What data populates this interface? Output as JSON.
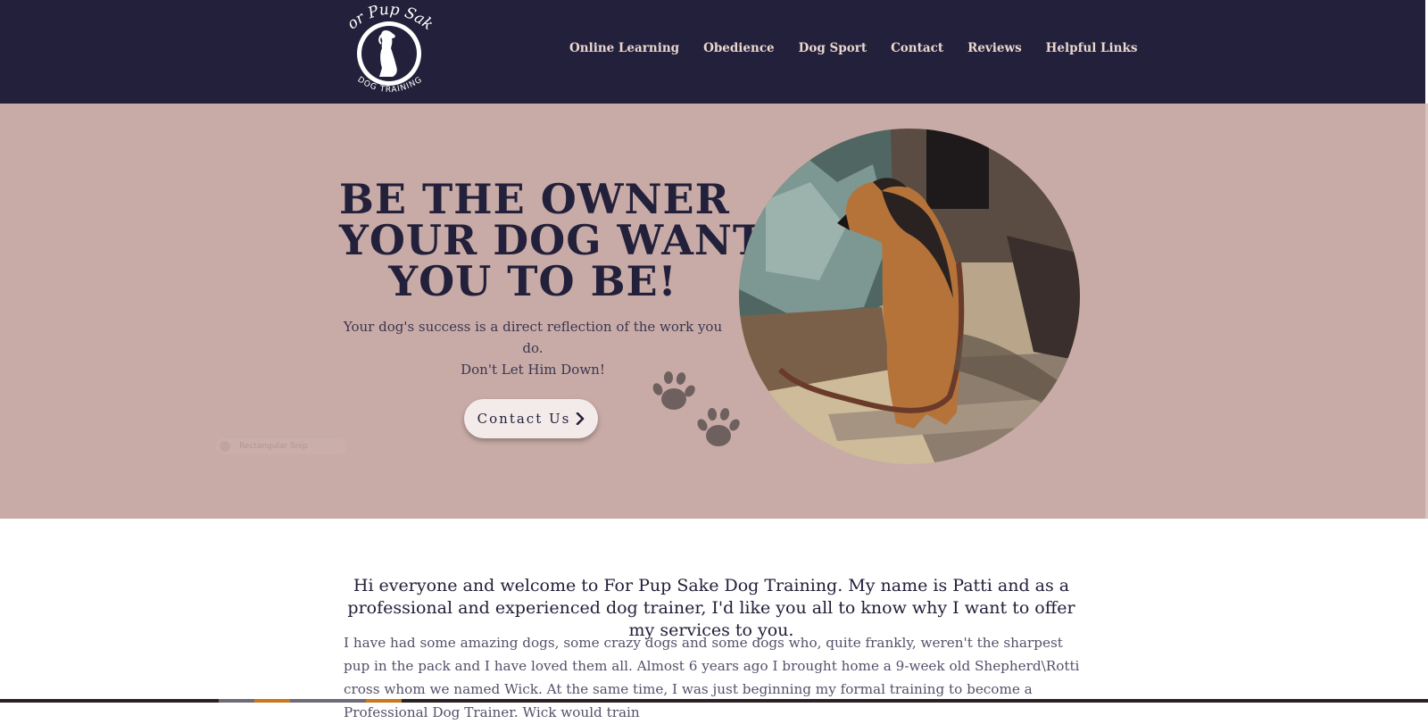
{
  "brand": {
    "logo_top_text": "For Pup Sake",
    "logo_bottom_text": "DOG TRAINING"
  },
  "nav": {
    "items": [
      {
        "label": "Online Learning"
      },
      {
        "label": "Obedience"
      },
      {
        "label": "Dog Sport"
      },
      {
        "label": "Contact"
      },
      {
        "label": "Reviews"
      },
      {
        "label": "Helpful Links"
      }
    ]
  },
  "hero": {
    "headline_lines": [
      "BE THE OWNER",
      "YOUR DOG WANTS",
      "YOU TO BE!"
    ],
    "sub_line1": "Your dog's success is a direct reflection of the work you do.",
    "sub_line2": "Don't Let Him Down!",
    "cta_label": "Contact Us",
    "snip_label": "Rectangular Snip"
  },
  "main": {
    "lead": "Hi everyone and welcome to For Pup Sake Dog Training.  My name is Patti and as a professional and experienced dog trainer, I'd like you all to know why I want to offer my services to you.",
    "body": "I have had some amazing dogs, some crazy dogs and some dogs who, quite frankly, weren't the sharpest pup in the pack and I have loved them all. Almost 6 years ago I brought home a 9-week old Shepherd\\Rotti cross whom we named Wick. At the same time, I was just beginning my formal training to become a Professional Dog Trainer. Wick would train"
  },
  "colors": {
    "header_bg": "#22203a",
    "nav_text": "#e9d6cf",
    "hero_bg": "#c8aba6",
    "headline": "#22203a",
    "button_bg": "#f3ebe9"
  },
  "icons": {
    "logo": "dog-silhouette-logo",
    "cta_arrow": "chevron-right-icon",
    "paws": "paw-prints-icon"
  }
}
